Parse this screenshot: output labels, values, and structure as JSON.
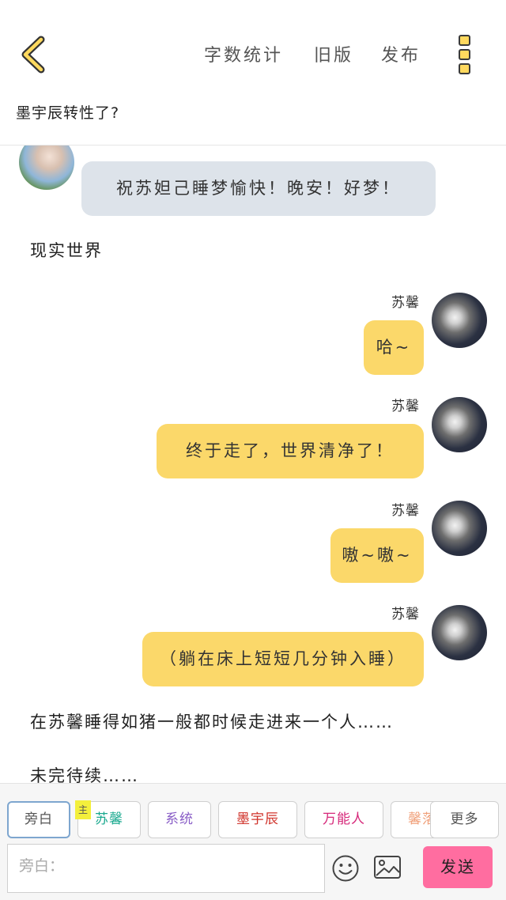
{
  "header": {
    "nav": [
      "字数统计",
      "旧版",
      "发布"
    ],
    "doc_title": "墨宇辰转性了?"
  },
  "messages": [
    {
      "type": "left",
      "speaker": "",
      "text": "祝苏妲己睡梦愉快！晚安！好梦！"
    },
    {
      "type": "narration",
      "text": "现实世界"
    },
    {
      "type": "right",
      "speaker": "苏馨",
      "text": "哈~"
    },
    {
      "type": "right",
      "speaker": "苏馨",
      "text": "终于走了，世界清净了！"
    },
    {
      "type": "right",
      "speaker": "苏馨",
      "text": "嗷~嗷~"
    },
    {
      "type": "right",
      "speaker": "苏馨",
      "text": "（躺在床上短短几分钟入睡）"
    },
    {
      "type": "narration",
      "text": "在苏馨睡得如猪一般都时候走进来一个人……"
    },
    {
      "type": "narration",
      "text": "未完待续……"
    }
  ],
  "roles": [
    {
      "label": "旁白",
      "color": "#555555"
    },
    {
      "label": "苏馨",
      "color": "#1aa98f"
    },
    {
      "label": "系统",
      "color": "#8a5fc7"
    },
    {
      "label": "墨宇辰",
      "color": "#d0342c"
    },
    {
      "label": "万能人",
      "color": "#d6287a"
    },
    {
      "label": "馨落",
      "color": "#f0a07a"
    }
  ],
  "main_tag": "主",
  "more_label": "更多",
  "input": {
    "placeholder": "旁白："
  },
  "send_label": "发送",
  "icons": [
    "back-chevron-icon",
    "more-vertical-icon",
    "emoji-icon",
    "image-icon"
  ],
  "colors": {
    "accent_yellow": "#fbd86a",
    "bubble_left": "#dde3ea",
    "send_pink": "#ff6da0",
    "active_border": "#7ea6cf"
  }
}
